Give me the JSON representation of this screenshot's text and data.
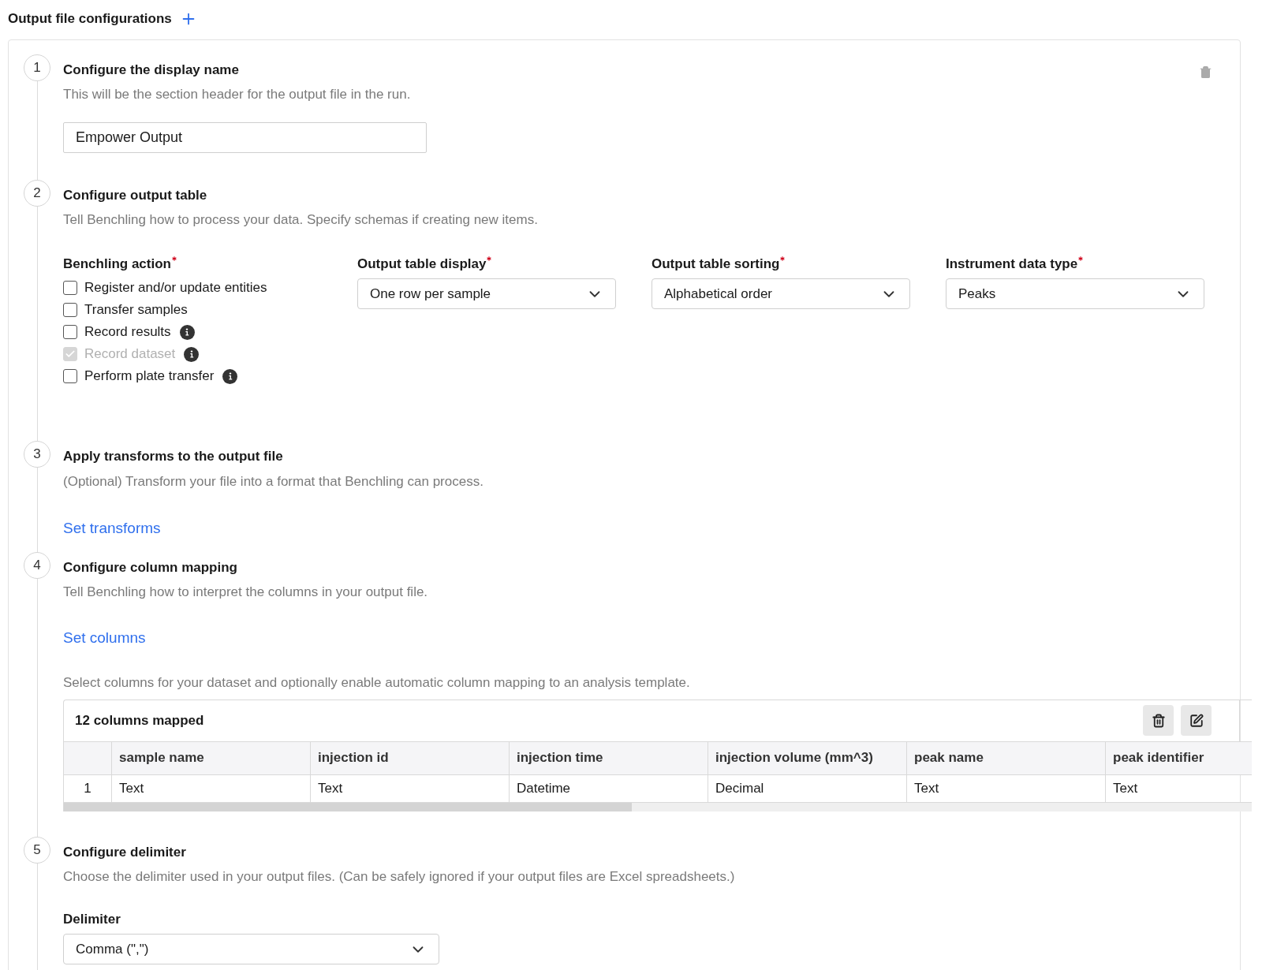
{
  "header": {
    "title": "Output file configurations"
  },
  "steps": [
    {
      "kind": "name",
      "number": "1",
      "title": "Configure the display name",
      "description": "This will be the section header for the output file in the run.",
      "value": "Empower Output"
    },
    {
      "kind": "table",
      "number": "2",
      "title": "Configure output table",
      "description": "Tell Benchling how to process your data. Specify schemas if creating new items.",
      "action_label": "Benchling action",
      "action_required": true,
      "actions": [
        {
          "label": "Register and/or update entities",
          "checked": false,
          "disabled": false,
          "info": false
        },
        {
          "label": "Transfer samples",
          "checked": false,
          "disabled": false,
          "info": false
        },
        {
          "label": "Record results",
          "checked": false,
          "disabled": false,
          "info": true
        },
        {
          "label": "Record dataset",
          "checked": true,
          "disabled": true,
          "info": true
        },
        {
          "label": "Perform plate transfer",
          "checked": false,
          "disabled": false,
          "info": true
        }
      ],
      "dropdowns": [
        {
          "label": "Output table display",
          "required": true,
          "value": "One row per sample"
        },
        {
          "label": "Output table sorting",
          "required": true,
          "value": "Alphabetical order"
        },
        {
          "label": "Instrument data type",
          "required": true,
          "value": "Peaks"
        }
      ]
    },
    {
      "kind": "transforms",
      "number": "3",
      "title": "Apply transforms to the output file",
      "description": "(Optional) Transform your file into a format that Benchling can process.",
      "link": "Set transforms"
    },
    {
      "kind": "columns",
      "number": "4",
      "title": "Configure column mapping",
      "description": "Tell Benchling how to interpret the columns in your output file.",
      "link": "Set columns",
      "note": "Select columns for your dataset and optionally enable automatic column mapping to an analysis template.",
      "table": {
        "title": "12 columns mapped",
        "columns": [
          "sample name",
          "injection id",
          "injection time",
          "injection volume (mm^3)",
          "peak name",
          "peak identifier"
        ],
        "rows": [
          {
            "number": "1",
            "cells": [
              "Text",
              "Text",
              "Datetime",
              "Decimal",
              "Text",
              "Text"
            ]
          }
        ]
      }
    },
    {
      "kind": "delimiter",
      "number": "5",
      "title": "Configure delimiter",
      "description": "Choose the delimiter used in your output files. (Can be safely ignored if your output files are Excel spreadsheets.)",
      "field_label": "Delimiter",
      "value": "Comma (\",\")"
    }
  ]
}
